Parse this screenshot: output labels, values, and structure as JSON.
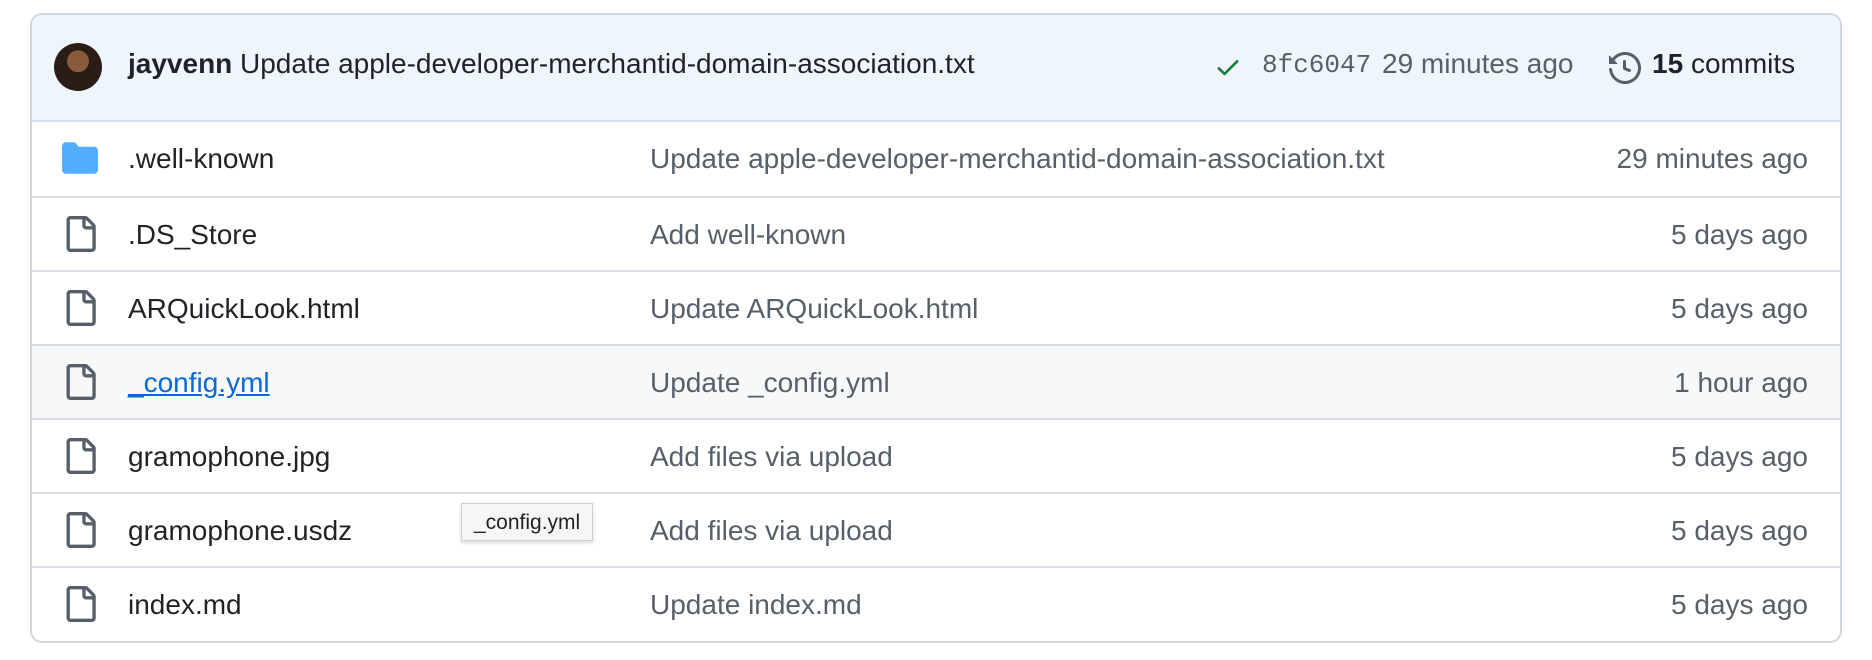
{
  "latest_commit": {
    "author": "jayvenn",
    "message": "Update apple-developer-merchantid-domain-association.txt",
    "sha": "8fc6047",
    "time": "29 minutes ago",
    "commit_count": "15",
    "commits_label": "commits",
    "status_color": "#1a7f37"
  },
  "files": [
    {
      "type": "folder",
      "icon": "folder-icon",
      "name": ".well-known",
      "message": "Update apple-developer-merchantid-domain-association.txt",
      "age": "29 minutes ago"
    },
    {
      "type": "file",
      "icon": "file-icon",
      "name": ".DS_Store",
      "message": "Add well-known",
      "age": "5 days ago"
    },
    {
      "type": "file",
      "icon": "file-icon",
      "name": "ARQuickLook.html",
      "message": "Update ARQuickLook.html",
      "age": "5 days ago"
    },
    {
      "type": "file",
      "icon": "file-icon",
      "name": "_config.yml",
      "message": "Update _config.yml",
      "age": "1 hour ago",
      "hovered": true
    },
    {
      "type": "file",
      "icon": "file-icon",
      "name": "gramophone.jpg",
      "message": "Add files via upload",
      "age": "5 days ago"
    },
    {
      "type": "file",
      "icon": "file-icon",
      "name": "gramophone.usdz",
      "message": "Add files via upload",
      "age": "5 days ago"
    },
    {
      "type": "file",
      "icon": "file-icon",
      "name": "index.md",
      "message": "Update index.md",
      "age": "5 days ago"
    }
  ],
  "tooltip": {
    "text": "_config.yml"
  },
  "colors": {
    "folder": "#54aeff",
    "link": "#0969da",
    "muted": "#57606a",
    "header_bg": "#eef5fd"
  }
}
